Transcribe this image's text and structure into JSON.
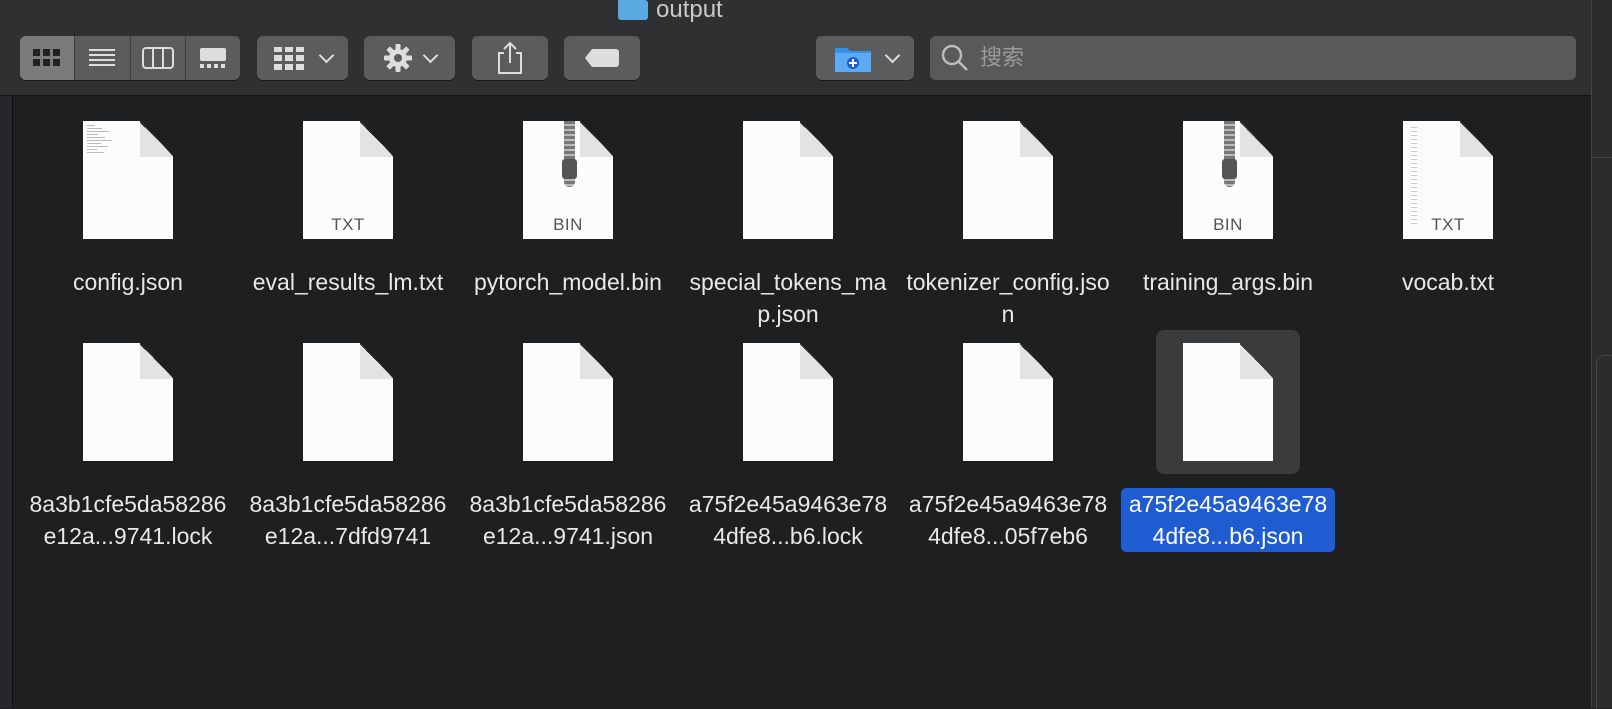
{
  "window": {
    "title": "output"
  },
  "toolbar": {
    "search_placeholder": "搜索"
  },
  "files": [
    {
      "name": "config.json",
      "kind": "lines",
      "type_label": ""
    },
    {
      "name": "eval_results_lm.txt",
      "kind": "text",
      "type_label": "TXT"
    },
    {
      "name": "pytorch_model.bin",
      "kind": "zip",
      "type_label": "BIN"
    },
    {
      "name": "special_tokens_map.json",
      "kind": "blank",
      "type_label": ""
    },
    {
      "name": "tokenizer_config.json",
      "kind": "blank",
      "type_label": ""
    },
    {
      "name": "training_args.bin",
      "kind": "zip",
      "type_label": "BIN"
    },
    {
      "name": "vocab.txt",
      "kind": "vlines",
      "type_label": "TXT"
    },
    {
      "name": "8a3b1cfe5da58286e12a...9741.lock",
      "kind": "blank",
      "type_label": ""
    },
    {
      "name": "8a3b1cfe5da58286e12a...7dfd9741",
      "kind": "blank",
      "type_label": ""
    },
    {
      "name": "8a3b1cfe5da58286e12a...9741.json",
      "kind": "blank",
      "type_label": ""
    },
    {
      "name": "a75f2e45a9463e784dfe8...b6.lock",
      "kind": "blank",
      "type_label": ""
    },
    {
      "name": "a75f2e45a9463e784dfe8...05f7eb6",
      "kind": "blank",
      "type_label": ""
    },
    {
      "name": "a75f2e45a9463e784dfe8...b6.json",
      "kind": "blank",
      "type_label": "",
      "selected": true
    }
  ],
  "colors": {
    "selection": "#1f5bd1",
    "background": "#1e1f21",
    "toolbar": "#2f3032"
  }
}
